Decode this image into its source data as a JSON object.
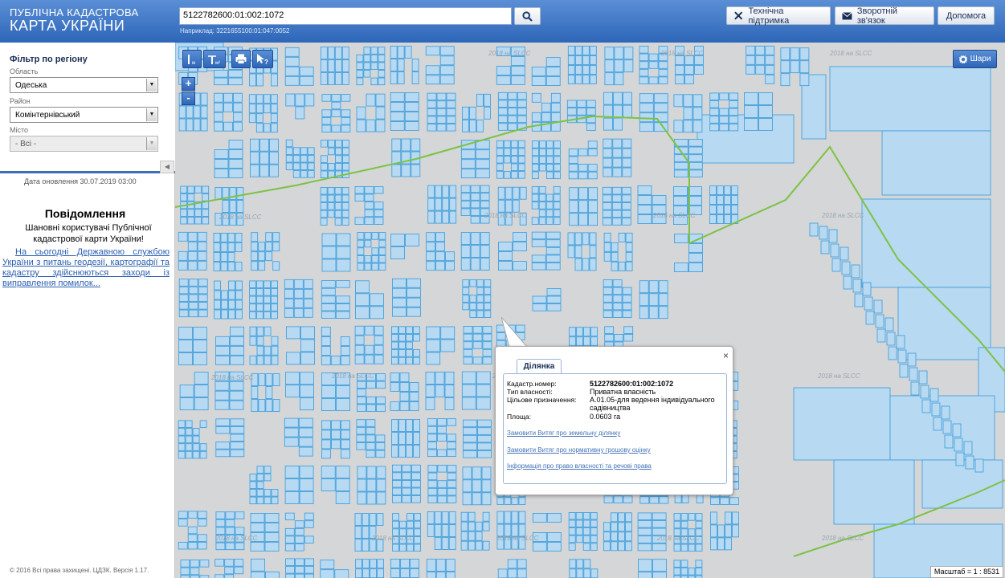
{
  "header": {
    "logo_line1": "ПУБЛІЧНА КАДАСТРОВА",
    "logo_line2": "КАРТА УКРАЇНИ",
    "search_value": "5122782600:01:002:1072",
    "search_example": "Наприклад: 3221655100:01:047:0052",
    "support_label": "Технічна підтримка",
    "feedback_label": "Зворотній зв'язок",
    "help_label": "Допомога"
  },
  "sidebar": {
    "filter_title": "Фільтр по регіону",
    "region_label": "Область",
    "region_value": "Одеська",
    "district_label": "Район",
    "district_value": "Комінтернівський",
    "city_label": "Місто",
    "city_value": "- Всі -",
    "updated": "Дата оновлення  30.07.2019 03:00",
    "notice_title": "Повідомлення",
    "notice_greeting": "Шановні користувачі Публічної кадастрової карти України!",
    "notice_link": "На сьогодні Державною службою України з питань геодезії, картографії та кадастру здійснюються заходи із виправлення помилок...",
    "copyright": "© 2016 Всі права захищені. ЦДЗК. Версія 1.17."
  },
  "map": {
    "layers_label": "Шари",
    "zoom_in": "+",
    "zoom_out": "-",
    "scale": "Масштаб = 1 : 8531",
    "watermark": "2018 на SLCC"
  },
  "popup": {
    "tab": "Ділянка",
    "close": "×",
    "rows": [
      {
        "label": "Кадастр.номер:",
        "value": "5122782600:01:002:1072"
      },
      {
        "label": "Тип власності:",
        "value": "Приватна власність"
      },
      {
        "label": "Цільове призначення:",
        "value": "А.01.05-для ведення індивідуального садівництва"
      },
      {
        "label": "Площа:",
        "value": "0.0603 га"
      }
    ],
    "links": [
      "Замовити Витяг про земельну ділянку",
      "Замовити Витяг про нормативну грошову оцінку",
      "Інформація про право власності та речові права"
    ]
  },
  "colors": {
    "header_blue": "#3a73c4",
    "parcel_fill": "#b7d9f2",
    "parcel_stroke": "#3a9ad9",
    "boundary_green": "#7dc243"
  }
}
